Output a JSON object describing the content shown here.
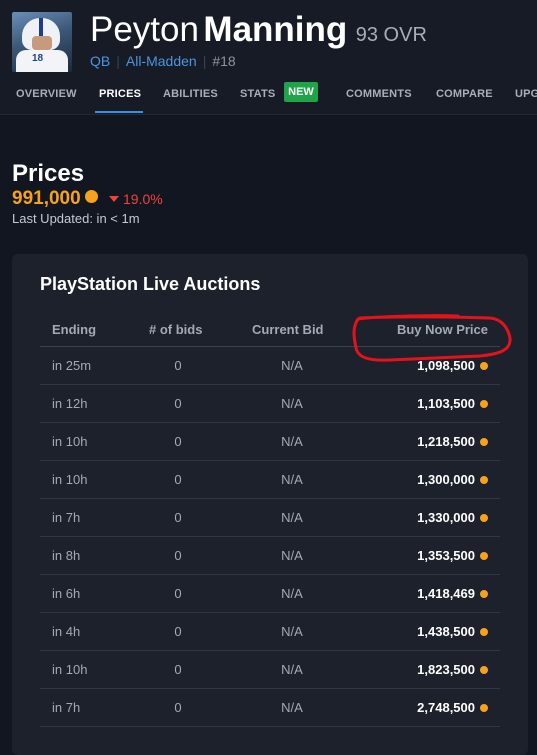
{
  "player": {
    "first_name": "Peyton",
    "last_name": "Manning",
    "ovr": "93 OVR",
    "position": "QB",
    "program": "All-Madden",
    "number": "#18",
    "jersey_number": "18"
  },
  "nav": {
    "tabs": [
      "OVERVIEW",
      "PRICES",
      "ABILITIES",
      "STATS",
      "COMMENTS",
      "COMPARE",
      "UPG"
    ],
    "active_tab": "PRICES",
    "new_badge": "NEW"
  },
  "prices": {
    "title": "Prices",
    "current_price": "991,000",
    "change": "19.0%",
    "change_direction": "down",
    "last_updated": "Last Updated: in < 1m"
  },
  "auctions": {
    "title": "PlayStation Live Auctions",
    "columns": [
      "Ending",
      "# of bids",
      "Current Bid",
      "Buy Now Price"
    ],
    "rows": [
      {
        "ending": "in 25m",
        "bids": "0",
        "current_bid": "N/A",
        "buy_now": "1,098,500"
      },
      {
        "ending": "in 12h",
        "bids": "0",
        "current_bid": "N/A",
        "buy_now": "1,103,500"
      },
      {
        "ending": "in 10h",
        "bids": "0",
        "current_bid": "N/A",
        "buy_now": "1,218,500"
      },
      {
        "ending": "in 10h",
        "bids": "0",
        "current_bid": "N/A",
        "buy_now": "1,300,000"
      },
      {
        "ending": "in 7h",
        "bids": "0",
        "current_bid": "N/A",
        "buy_now": "1,330,000"
      },
      {
        "ending": "in 8h",
        "bids": "0",
        "current_bid": "N/A",
        "buy_now": "1,353,500"
      },
      {
        "ending": "in 6h",
        "bids": "0",
        "current_bid": "N/A",
        "buy_now": "1,418,469"
      },
      {
        "ending": "in 4h",
        "bids": "0",
        "current_bid": "N/A",
        "buy_now": "1,438,500"
      },
      {
        "ending": "in 10h",
        "bids": "0",
        "current_bid": "N/A",
        "buy_now": "1,823,500"
      },
      {
        "ending": "in 7h",
        "bids": "0",
        "current_bid": "N/A",
        "buy_now": "2,748,500"
      }
    ],
    "circled_row": 6
  },
  "colors": {
    "background": "#121620",
    "card": "#1c212c",
    "coin": "#f7a21b",
    "link": "#4d95df",
    "negative": "#f0443a",
    "new_badge": "#1fa44a",
    "annotation": "#e3131b"
  },
  "icons": {
    "coin": "coin-icon",
    "trend": "triangle-down-icon"
  }
}
